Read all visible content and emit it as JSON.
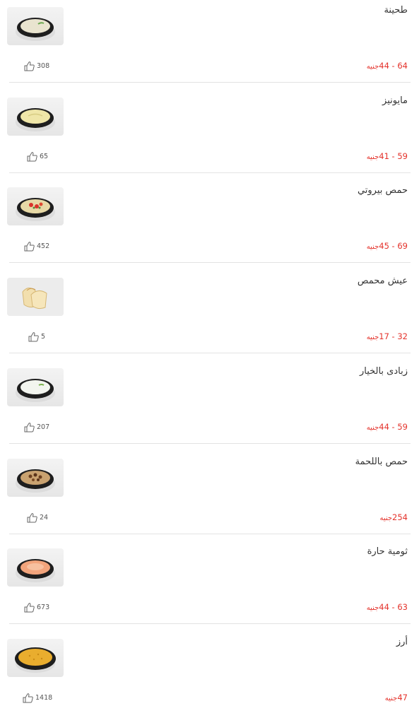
{
  "menu": {
    "items": [
      {
        "name": "طحينة",
        "price": "44 - 64",
        "currency": "جنيه",
        "likes": "308",
        "dish": "tahini-bowl"
      },
      {
        "name": "مايونيز",
        "price": "41 - 59",
        "currency": "جنيه",
        "likes": "65",
        "dish": "mayonnaise-bowl"
      },
      {
        "name": "حمص بيروتي",
        "price": "45 - 69",
        "currency": "جنيه",
        "likes": "452",
        "dish": "beiruti-hummus-bowl"
      },
      {
        "name": "عيش محمص",
        "price": "17 - 32",
        "currency": "جنيه",
        "likes": "5",
        "dish": "toasted-bread-plate"
      },
      {
        "name": "زبادى بالخيار",
        "price": "44 - 59",
        "currency": "جنيه",
        "likes": "207",
        "dish": "yogurt-cucumber-bowl"
      },
      {
        "name": "حمص باللحمة",
        "price": "254",
        "currency": "جنيه",
        "likes": "24",
        "dish": "hummus-meat-bowl"
      },
      {
        "name": "ثومية حارة",
        "price": "44 - 63",
        "currency": "جنيه",
        "likes": "673",
        "dish": "spicy-garlic-bowl"
      },
      {
        "name": "أرز",
        "price": "47",
        "currency": "جنيه",
        "likes": "1418",
        "dish": "rice-bowl"
      }
    ]
  },
  "icons": {
    "like": "thumbs-up-icon"
  },
  "colors": {
    "price": "#e4322b",
    "name": "#333333",
    "likes": "#555555",
    "divider": "#e3e3e3"
  }
}
